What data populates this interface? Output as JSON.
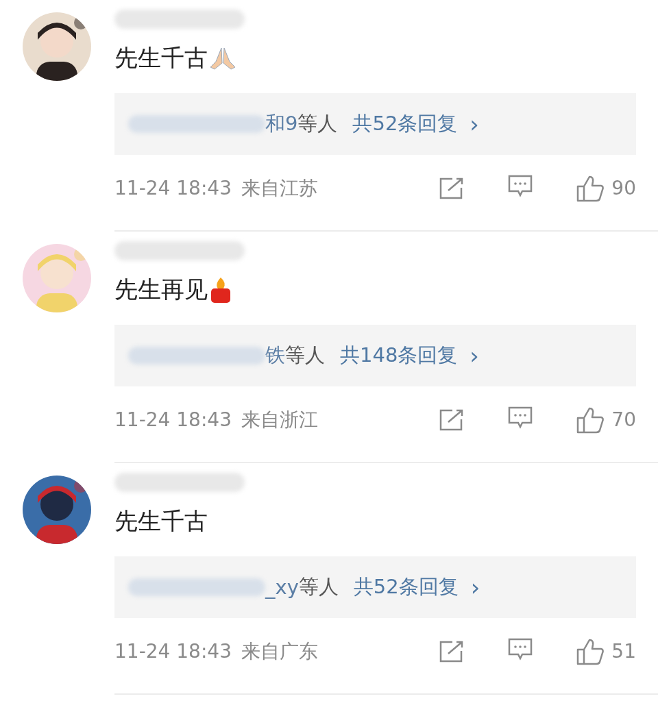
{
  "comments": [
    {
      "text": "先生千古",
      "emoji": {
        "kind": "pray"
      },
      "reply_names": "和9",
      "reply_suffix": "等人",
      "reply_count": "共52条回复",
      "reply_arrow": "›",
      "time": "11-24 18:43",
      "location": "来自江苏",
      "likes": "90"
    },
    {
      "text": "先生再见",
      "emoji": {
        "kind": "candle"
      },
      "reply_names": "铁",
      "reply_suffix": "等人",
      "reply_count": "共148条回复",
      "reply_arrow": "›",
      "time": "11-24 18:43",
      "location": "来自浙江",
      "likes": "70"
    },
    {
      "text": "先生千古",
      "reply_names": "_xy",
      "reply_suffix": "等人",
      "reply_count": "共52条回复",
      "reply_arrow": "›",
      "time": "11-24 18:43",
      "location": "来自广东",
      "likes": "51"
    }
  ]
}
